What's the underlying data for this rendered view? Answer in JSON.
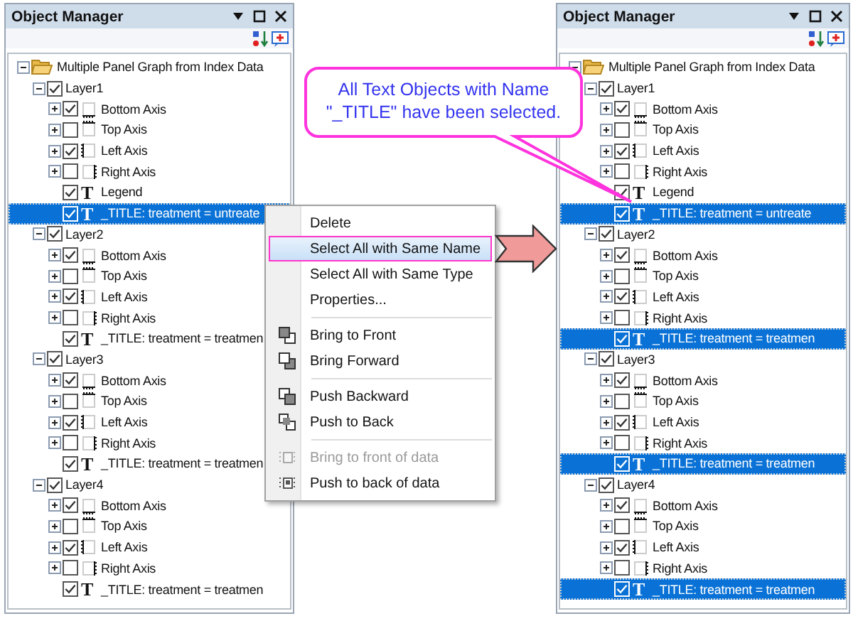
{
  "panels": [
    {
      "title": "Object Manager",
      "tree": {
        "kind": "folder",
        "label": "Multiple Panel Graph from Index Data",
        "expanded": true,
        "selected": false,
        "children": [
          {
            "label": "Layer1",
            "expanded": true,
            "checked": true,
            "selected": false,
            "children": [
              {
                "kind": "bottom-axis",
                "label": "Bottom Axis",
                "expanded": false,
                "checked": true,
                "selected": false
              },
              {
                "kind": "top-axis",
                "label": "Top Axis",
                "expanded": false,
                "checked": false,
                "selected": false
              },
              {
                "kind": "left-axis",
                "label": "Left Axis",
                "expanded": false,
                "checked": true,
                "selected": false
              },
              {
                "kind": "right-axis",
                "label": "Right Axis",
                "expanded": false,
                "checked": false,
                "selected": false
              },
              {
                "kind": "text",
                "glyph": "T",
                "label": "Legend",
                "checked": true,
                "selected": false
              },
              {
                "kind": "text",
                "glyph": "T",
                "label": "_TITLE: treatment = untreate",
                "checked": true,
                "selected": true
              }
            ]
          },
          {
            "label": "Layer2",
            "expanded": true,
            "checked": true,
            "selected": false,
            "children": [
              {
                "kind": "bottom-axis",
                "label": "Bottom Axis",
                "expanded": false,
                "checked": true,
                "selected": false
              },
              {
                "kind": "top-axis",
                "label": "Top Axis",
                "expanded": false,
                "checked": false,
                "selected": false
              },
              {
                "kind": "left-axis",
                "label": "Left Axis",
                "expanded": false,
                "checked": true,
                "selected": false
              },
              {
                "kind": "right-axis",
                "label": "Right Axis",
                "expanded": false,
                "checked": false,
                "selected": false
              },
              {
                "kind": "text",
                "glyph": "T",
                "label": "_TITLE: treatment = treatmen",
                "checked": true,
                "selected": false
              }
            ]
          },
          {
            "label": "Layer3",
            "expanded": true,
            "checked": true,
            "selected": false,
            "children": [
              {
                "kind": "bottom-axis",
                "label": "Bottom Axis",
                "expanded": false,
                "checked": true,
                "selected": false
              },
              {
                "kind": "top-axis",
                "label": "Top Axis",
                "expanded": false,
                "checked": false,
                "selected": false
              },
              {
                "kind": "left-axis",
                "label": "Left Axis",
                "expanded": false,
                "checked": true,
                "selected": false
              },
              {
                "kind": "right-axis",
                "label": "Right Axis",
                "expanded": false,
                "checked": false,
                "selected": false
              },
              {
                "kind": "text",
                "glyph": "T",
                "label": "_TITLE: treatment = treatmen",
                "checked": true,
                "selected": false
              }
            ]
          },
          {
            "label": "Layer4",
            "expanded": true,
            "checked": true,
            "selected": false,
            "children": [
              {
                "kind": "bottom-axis",
                "label": "Bottom Axis",
                "expanded": false,
                "checked": true,
                "selected": false
              },
              {
                "kind": "top-axis",
                "label": "Top Axis",
                "expanded": false,
                "checked": false,
                "selected": false
              },
              {
                "kind": "left-axis",
                "label": "Left Axis",
                "expanded": false,
                "checked": true,
                "selected": false
              },
              {
                "kind": "right-axis",
                "label": "Right Axis",
                "expanded": false,
                "checked": false,
                "selected": false
              },
              {
                "kind": "text",
                "glyph": "T",
                "label": "_TITLE: treatment = treatmen",
                "checked": true,
                "selected": false
              }
            ]
          }
        ]
      }
    },
    {
      "title": "Object Manager",
      "tree": {
        "kind": "folder",
        "label": "Multiple Panel Graph from Index Data",
        "expanded": true,
        "selected": false,
        "children": [
          {
            "label": "Layer1",
            "expanded": true,
            "checked": true,
            "selected": false,
            "children": [
              {
                "kind": "bottom-axis",
                "label": "Bottom Axis",
                "expanded": false,
                "checked": true,
                "selected": false
              },
              {
                "kind": "top-axis",
                "label": "Top Axis",
                "expanded": false,
                "checked": false,
                "selected": false
              },
              {
                "kind": "left-axis",
                "label": "Left Axis",
                "expanded": false,
                "checked": true,
                "selected": false
              },
              {
                "kind": "right-axis",
                "label": "Right Axis",
                "expanded": false,
                "checked": false,
                "selected": false
              },
              {
                "kind": "text",
                "glyph": "T",
                "label": "Legend",
                "checked": true,
                "selected": false
              },
              {
                "kind": "text",
                "glyph": "T",
                "label": "_TITLE: treatment = untreate",
                "checked": true,
                "selected": true
              }
            ]
          },
          {
            "label": "Layer2",
            "expanded": true,
            "checked": true,
            "selected": false,
            "children": [
              {
                "kind": "bottom-axis",
                "label": "Bottom Axis",
                "expanded": false,
                "checked": true,
                "selected": false
              },
              {
                "kind": "top-axis",
                "label": "Top Axis",
                "expanded": false,
                "checked": false,
                "selected": false
              },
              {
                "kind": "left-axis",
                "label": "Left Axis",
                "expanded": false,
                "checked": true,
                "selected": false
              },
              {
                "kind": "right-axis",
                "label": "Right Axis",
                "expanded": false,
                "checked": false,
                "selected": false
              },
              {
                "kind": "text",
                "glyph": "T",
                "label": "_TITLE: treatment = treatmen",
                "checked": true,
                "selected": true
              }
            ]
          },
          {
            "label": "Layer3",
            "expanded": true,
            "checked": true,
            "selected": false,
            "children": [
              {
                "kind": "bottom-axis",
                "label": "Bottom Axis",
                "expanded": false,
                "checked": true,
                "selected": false
              },
              {
                "kind": "top-axis",
                "label": "Top Axis",
                "expanded": false,
                "checked": false,
                "selected": false
              },
              {
                "kind": "left-axis",
                "label": "Left Axis",
                "expanded": false,
                "checked": true,
                "selected": false
              },
              {
                "kind": "right-axis",
                "label": "Right Axis",
                "expanded": false,
                "checked": false,
                "selected": false
              },
              {
                "kind": "text",
                "glyph": "T",
                "label": "_TITLE: treatment = treatmen",
                "checked": true,
                "selected": true
              }
            ]
          },
          {
            "label": "Layer4",
            "expanded": true,
            "checked": true,
            "selected": false,
            "children": [
              {
                "kind": "bottom-axis",
                "label": "Bottom Axis",
                "expanded": false,
                "checked": true,
                "selected": false
              },
              {
                "kind": "top-axis",
                "label": "Top Axis",
                "expanded": false,
                "checked": false,
                "selected": false
              },
              {
                "kind": "left-axis",
                "label": "Left Axis",
                "expanded": false,
                "checked": true,
                "selected": false
              },
              {
                "kind": "right-axis",
                "label": "Right Axis",
                "expanded": false,
                "checked": false,
                "selected": false
              },
              {
                "kind": "text",
                "glyph": "T",
                "label": "_TITLE: treatment = treatmen",
                "checked": true,
                "selected": true
              }
            ]
          }
        ]
      }
    }
  ],
  "context_menu": {
    "items": [
      {
        "kind": "plain",
        "label": "Delete",
        "selected": false,
        "disabled": false
      },
      {
        "kind": "plain",
        "label": "Select All with Same Name",
        "selected": true,
        "disabled": false
      },
      {
        "kind": "plain",
        "label": "Select All with Same Type",
        "selected": false,
        "disabled": false
      },
      {
        "kind": "plain",
        "label": "Properties...",
        "selected": false,
        "disabled": false
      },
      {
        "kind": "separator"
      },
      {
        "kind": "bring-front",
        "label": "Bring to Front",
        "selected": false,
        "disabled": false
      },
      {
        "kind": "bring-forward",
        "label": "Bring Forward",
        "selected": false,
        "disabled": false
      },
      {
        "kind": "separator"
      },
      {
        "kind": "push-backward",
        "label": "Push Backward",
        "selected": false,
        "disabled": false
      },
      {
        "kind": "push-back",
        "label": "Push to Back",
        "selected": false,
        "disabled": false
      },
      {
        "kind": "separator"
      },
      {
        "kind": "front-of-data",
        "label": "Bring to front of data",
        "selected": false,
        "disabled": true
      },
      {
        "kind": "back-of-data",
        "label": "Push to back of data",
        "selected": false,
        "disabled": false
      }
    ]
  },
  "callout": {
    "text": "All Text Objects with Name\n\"_TITLE\" have been selected."
  }
}
